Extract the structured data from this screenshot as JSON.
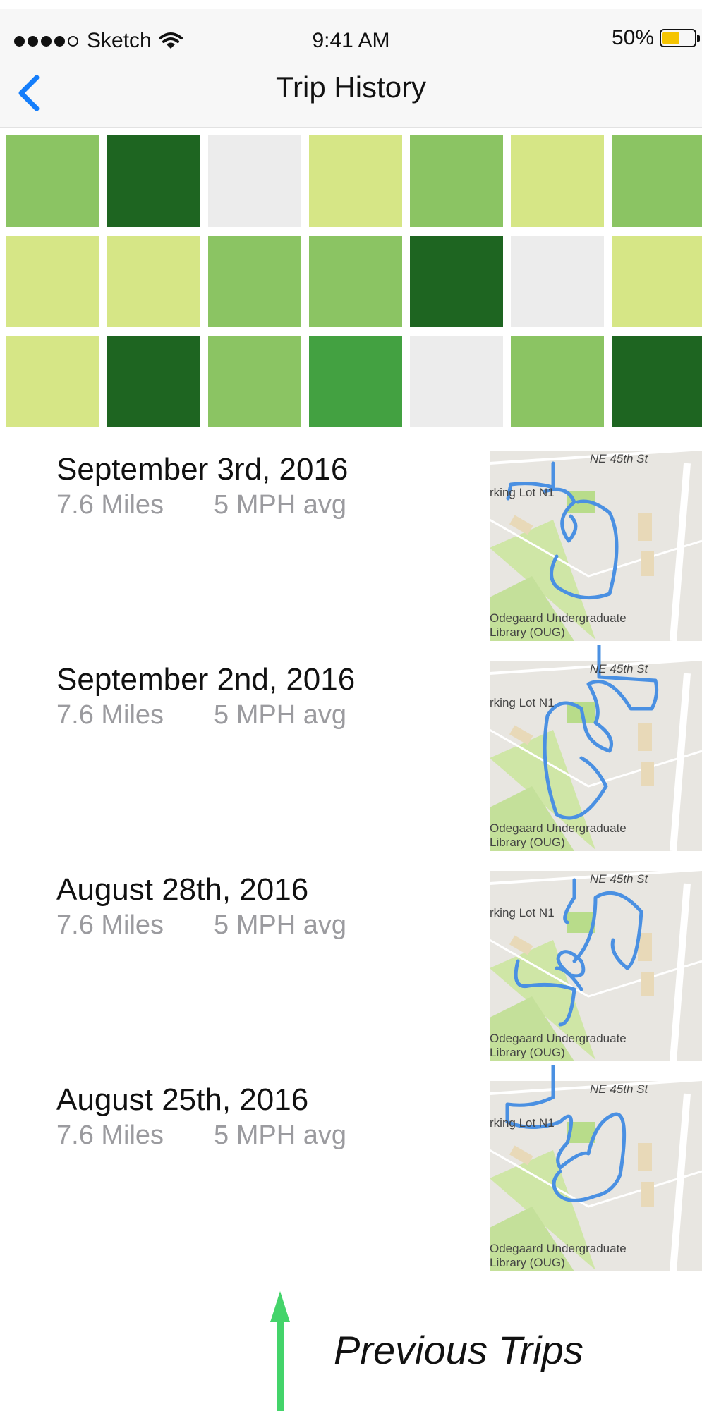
{
  "status_bar": {
    "carrier": "Sketch",
    "time": "9:41 AM",
    "battery": "50%",
    "battery_level": 0.5,
    "signal_icon": "signal-dots-icon",
    "wifi_icon": "wifi-icon",
    "battery_icon": "battery-icon"
  },
  "nav": {
    "title": "Trip History",
    "back_icon": "chevron-left-icon"
  },
  "colors": {
    "accent": "#157efb",
    "light": "#d6e686",
    "mid": "#8bc463",
    "strong": "#43a141",
    "dark": "#1e6521",
    "empty": "#ececec",
    "route": "#4a90e2",
    "arrow": "#44d46a"
  },
  "activity_grid": [
    [
      "mid",
      "dark",
      "empty",
      "light",
      "mid",
      "light",
      "mid"
    ],
    [
      "light",
      "light",
      "mid",
      "mid",
      "dark",
      "empty",
      "light"
    ],
    [
      "light",
      "dark",
      "mid",
      "strong",
      "empty",
      "mid",
      "dark"
    ]
  ],
  "trips": [
    {
      "date": "September 3rd, 2016",
      "miles": "7.6 Miles",
      "speed": "5 MPH avg"
    },
    {
      "date": "September 2nd, 2016",
      "miles": "7.6 Miles",
      "speed": "5 MPH avg"
    },
    {
      "date": "August 28th, 2016",
      "miles": "7.6 Miles",
      "speed": "5 MPH avg"
    },
    {
      "date": "August 25th, 2016",
      "miles": "7.6 Miles",
      "speed": "5 MPH avg"
    }
  ],
  "map_labels": {
    "street": "NE 45th St",
    "lot": "rking Lot N1",
    "library_1": "Odegaard Undergraduate",
    "library_2": "Library (OUG)"
  },
  "annotation": {
    "caption": "Previous Trips",
    "arrow_icon": "arrow-up-icon"
  }
}
